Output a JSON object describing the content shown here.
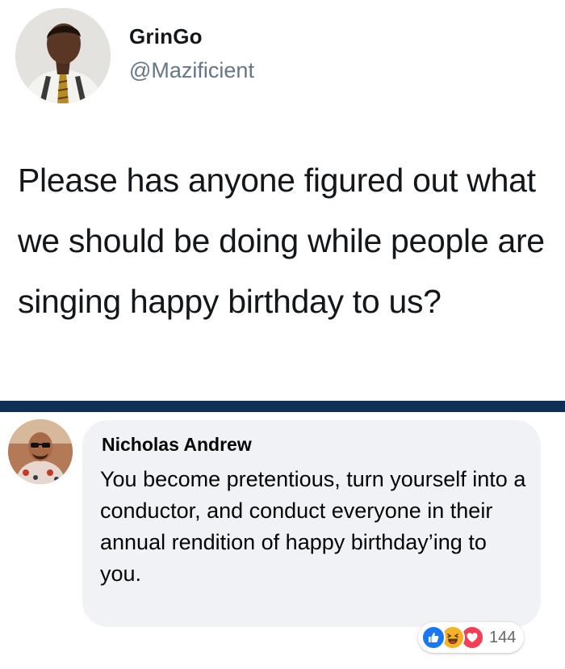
{
  "tweet": {
    "display_name": "GrinGo",
    "handle": "@Mazificient",
    "text": "Please has anyone figured out what we should be doing while people are singing happy birthday to us?"
  },
  "comment": {
    "author": "Nicholas Andrew",
    "text": "You become pretentious, turn yourself into a conductor, and conduct everyone in their annual rendition of happy birthday’ing to you.",
    "reactions": {
      "icons": [
        "like-icon",
        "haha-icon",
        "love-icon"
      ],
      "count": "144"
    }
  },
  "colors": {
    "divider": "#0f2f54",
    "handle": "#657786",
    "bubble": "#f0f2f5",
    "like": "#1877f2",
    "haha": "#f7b125",
    "love": "#f33e58"
  }
}
